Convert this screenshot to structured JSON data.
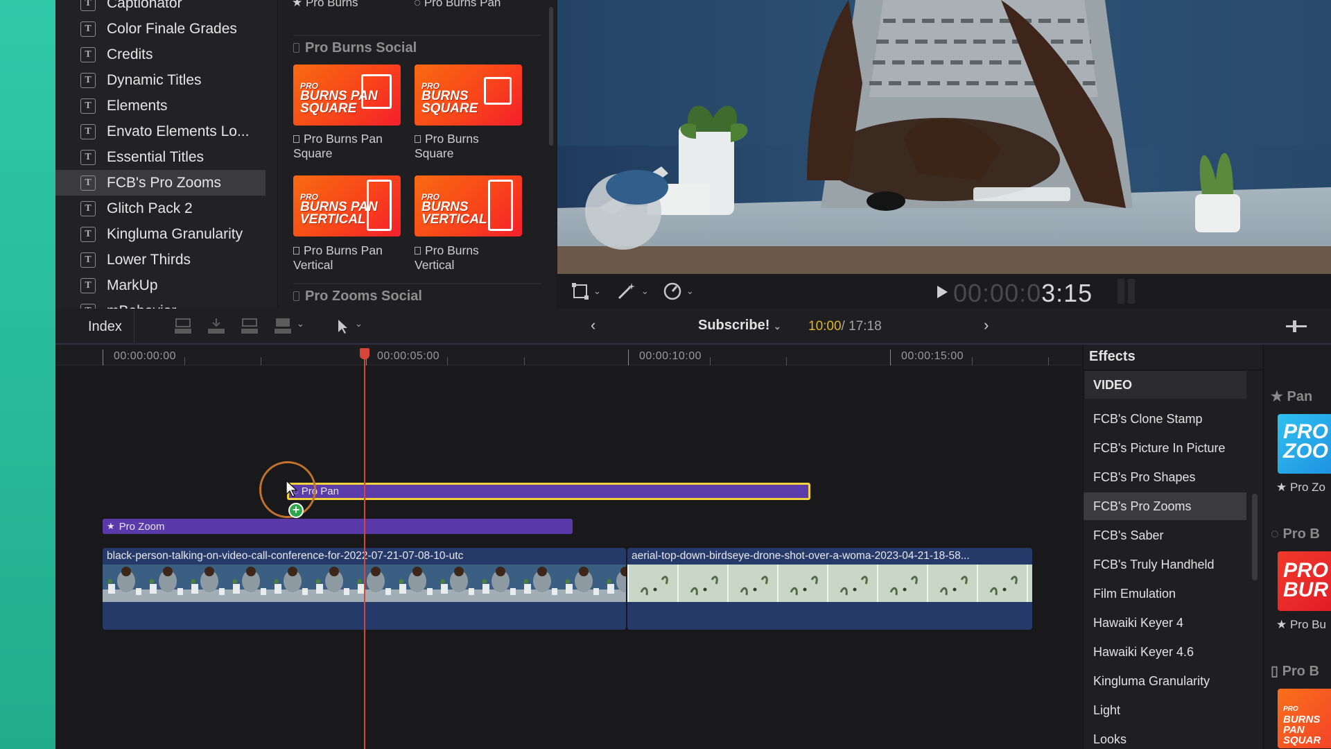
{
  "sidebar": {
    "items": [
      {
        "label": "Captionator"
      },
      {
        "label": "Color Finale Grades"
      },
      {
        "label": "Credits"
      },
      {
        "label": "Dynamic Titles"
      },
      {
        "label": "Elements"
      },
      {
        "label": "Envato Elements Lo..."
      },
      {
        "label": "Essential Titles"
      },
      {
        "label": "FCB's Pro Zooms",
        "selected": true
      },
      {
        "label": "Glitch Pack 2"
      },
      {
        "label": "Kingluma Granularity"
      },
      {
        "label": "Lower Thirds"
      },
      {
        "label": "MarkUp"
      },
      {
        "label": "mBehavior"
      }
    ],
    "icon_glyph": "T"
  },
  "browser": {
    "top_labels": [
      "Pro Burns",
      "Pro Burns Pan"
    ],
    "category1": "Pro Burns Social",
    "category2": "Pro Zooms Social",
    "thumbs": [
      {
        "line1": "PRO",
        "line2": "BURNS PAN",
        "line3": "SQUARE",
        "label1": "Pro Burns Pan",
        "label2": "Square"
      },
      {
        "line1": "PRO",
        "line2": "BURNS",
        "line3": "SQUARE",
        "label1": "Pro Burns",
        "label2": "Square"
      },
      {
        "line1": "PRO",
        "line2": "BURNS PAN",
        "line3": "VERTICAL",
        "label1": "Pro Burns Pan",
        "label2": "Vertical"
      },
      {
        "line1": "PRO",
        "line2": "BURNS",
        "line3": "VERTICAL",
        "label1": "Pro Burns",
        "label2": "Vertical"
      }
    ]
  },
  "viewer": {
    "timecode_dim": "00:00:0",
    "timecode_bright": "3:15"
  },
  "toolbar": {
    "index_label": "Index",
    "project_name": "Subscribe!",
    "duration_current": "10:00",
    "duration_total": "/ 17:18"
  },
  "timeline": {
    "ruler": [
      "00:00:00:00",
      "00:00:05:00",
      "00:00:10:00",
      "00:00:15:00"
    ],
    "clip_pro_pan": "Pro Pan",
    "clip_pro_zoom": "Pro Zoom",
    "video_clip_1": "black-person-talking-on-video-call-conference-for-2022-07-21-07-08-10-utc",
    "video_clip_2": "aerial-top-down-birdseye-drone-shot-over-a-woma-2023-04-21-18-58..."
  },
  "effects": {
    "title": "Effects",
    "section": "VIDEO",
    "items": [
      {
        "label": "FCB's Clone Stamp"
      },
      {
        "label": "FCB's Picture In Picture"
      },
      {
        "label": "FCB's Pro Shapes"
      },
      {
        "label": "FCB's Pro Zooms",
        "selected": true
      },
      {
        "label": "FCB's Saber"
      },
      {
        "label": "FCB's Truly Handheld"
      },
      {
        "label": "Film Emulation"
      },
      {
        "label": "Hawaiki Keyer 4"
      },
      {
        "label": "Hawaiki Keyer 4.6"
      },
      {
        "label": "Kingluma Granularity"
      },
      {
        "label": "Light"
      },
      {
        "label": "Looks"
      }
    ]
  },
  "preview": {
    "head1": "Pan",
    "label1": "Pro Zo",
    "head2": "Pro B",
    "label2": "Pro Bu",
    "head3": "Pro B",
    "thumb1_text": "PRO ZOO",
    "thumb2_text": "PRO BUR",
    "thumb3_line1": "PRO",
    "thumb3_line2": "BURNS PAN",
    "thumb3_line3": "SQUAR"
  },
  "colors": {
    "accent_teal": "#2fc9a8",
    "selection_yellow": "#f2d23a",
    "title_purple": "#5a3aa8",
    "clip_blue": "#2b3f70",
    "playhead_red": "#d6453a",
    "timecode_yellow": "#e0b52b"
  }
}
